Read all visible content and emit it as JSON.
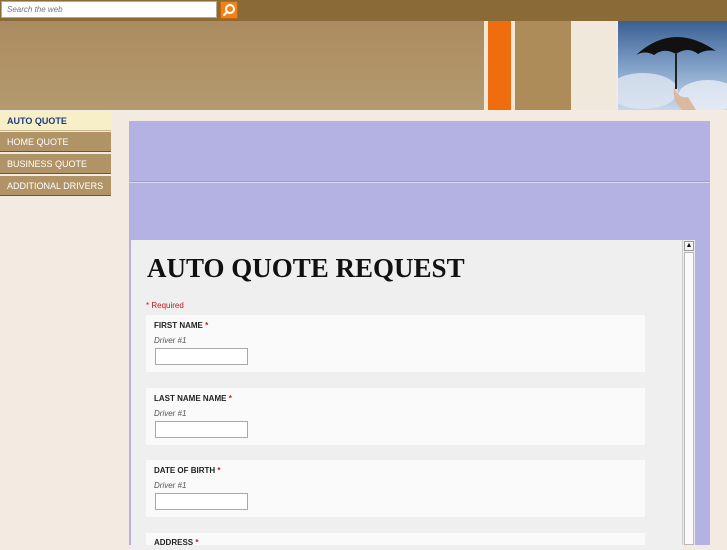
{
  "search": {
    "placeholder": "Search the web",
    "button_icon": "search-icon"
  },
  "banner": {
    "photo_icon": "umbrella-photo"
  },
  "sidebar": {
    "items": [
      {
        "label": "AUTO QUOTE",
        "active": true
      },
      {
        "label": "HOME QUOTE",
        "active": false
      },
      {
        "label": "BUSINESS QUOTE",
        "active": false
      },
      {
        "label": "ADDITIONAL DRIVERS",
        "active": false
      }
    ]
  },
  "form": {
    "title": "AUTO QUOTE REQUEST",
    "required_note": "* Required",
    "fields": [
      {
        "label": "FIRST NAME",
        "required_mark": "*",
        "help": "Driver #1",
        "value": ""
      },
      {
        "label": "LAST NAME NAME",
        "required_mark": "*",
        "help": "Driver #1",
        "value": ""
      },
      {
        "label": "DATE OF BIRTH",
        "required_mark": "*",
        "help": "Driver #1",
        "value": ""
      },
      {
        "label": "ADDRESS",
        "required_mark": "*",
        "help": "",
        "value": ""
      }
    ]
  },
  "colors": {
    "topbar": "#8a6a36",
    "accent_orange": "#ef6c0f",
    "nav_tan": "#b09366",
    "nav_active": "#f7efc8",
    "content_purple": "#b3b2e3",
    "required_red": "#c0191b"
  }
}
